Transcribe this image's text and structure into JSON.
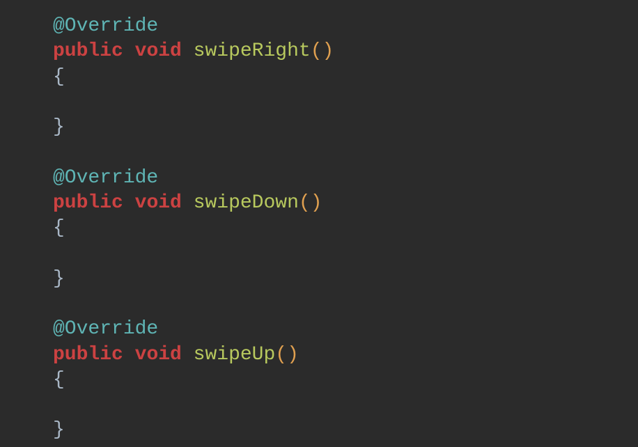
{
  "code": {
    "methods": [
      {
        "annotation": "@Override",
        "modifier1": "public",
        "modifier2": "void",
        "name": "swipeRight",
        "open_paren": "(",
        "close_paren": ")",
        "open_brace": "{",
        "close_brace": "}"
      },
      {
        "annotation": "@Override",
        "modifier1": "public",
        "modifier2": "void",
        "name": "swipeDown",
        "open_paren": "(",
        "close_paren": ")",
        "open_brace": "{",
        "close_brace": "}"
      },
      {
        "annotation": "@Override",
        "modifier1": "public",
        "modifier2": "void",
        "name": "swipeUp",
        "open_paren": "(",
        "close_paren": ")",
        "open_brace": "{",
        "close_brace": "}"
      }
    ]
  }
}
